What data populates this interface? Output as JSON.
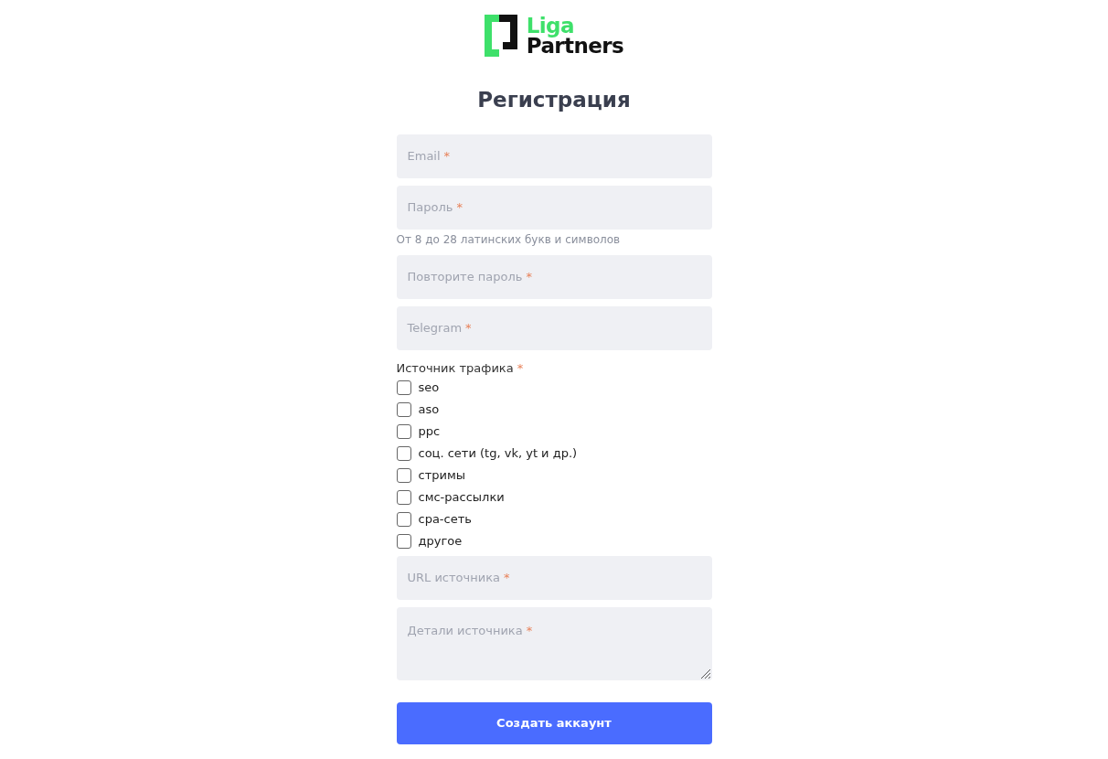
{
  "logo": {
    "line_1": "Liga",
    "line_2": "Partners"
  },
  "title": "Регистрация",
  "fields_top": [
    {
      "kind": "input",
      "placeholder": "Email",
      "required_mark": "*"
    },
    {
      "kind": "input",
      "placeholder": "Пароль",
      "required_mark": "*",
      "hint": "От 8 до 28 латинских букв и символов"
    },
    {
      "kind": "input",
      "placeholder": "Повторите пароль",
      "required_mark": "*"
    },
    {
      "kind": "input",
      "placeholder": "Telegram",
      "required_mark": "*"
    }
  ],
  "traffic_source": {
    "label": "Источник трафика",
    "required_mark": "*",
    "options": [
      {
        "label": "seo",
        "checked": false
      },
      {
        "label": "aso",
        "checked": false
      },
      {
        "label": "ppc",
        "checked": false
      },
      {
        "label": "соц. сети (tg, vk, yt и др.)",
        "checked": false
      },
      {
        "label": "стримы",
        "checked": false
      },
      {
        "label": "смс-рассылки",
        "checked": false
      },
      {
        "label": "cpa-сеть",
        "checked": false
      },
      {
        "label": "другое",
        "checked": false
      }
    ]
  },
  "fields_bottom": [
    {
      "kind": "input",
      "placeholder": "URL источника",
      "required_mark": "*"
    },
    {
      "kind": "textarea",
      "placeholder": "Детали источника",
      "required_mark": "*"
    }
  ],
  "submit": "Создать аккаунт"
}
